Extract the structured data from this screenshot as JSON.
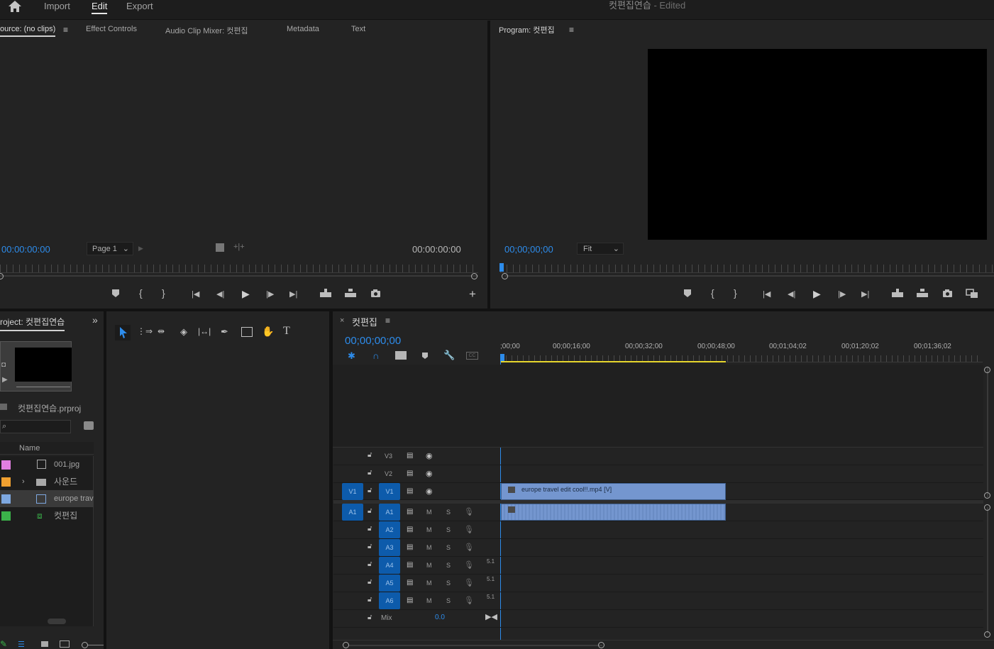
{
  "menu": {
    "import": "Import",
    "edit": "Edit",
    "export": "Export"
  },
  "window_title": "컷편집연습",
  "window_status": "- Edited",
  "source_panel": {
    "tabs": [
      "ource: (no clips)",
      "Effect Controls",
      "Audio Clip Mixer: 컷편집",
      "Metadata",
      "Text"
    ],
    "timecode_left": "00:00:00:00",
    "timecode_right": "00:00:00:00",
    "page_select": "Page 1"
  },
  "program_panel": {
    "tab": "Program: 컷편집",
    "timecode": "00;00;00;00",
    "fit_select": "Fit"
  },
  "project_panel": {
    "tab": "roject: 컷편집연습",
    "file": "컷편집연습.prproj",
    "column_name": "Name",
    "items": [
      {
        "label": "001.jpg",
        "color": "#e07ee0",
        "icon": "image-icon"
      },
      {
        "label": "사운드",
        "color": "#f0a030",
        "icon": "folder-icon"
      },
      {
        "label": "europe trav",
        "color": "#7ea8e0",
        "icon": "video-clip-icon"
      },
      {
        "label": "컷편집",
        "color": "#3bb34a",
        "icon": "sequence-icon"
      }
    ]
  },
  "timeline": {
    "tab": "컷편집",
    "timecode": "00;00;00;00",
    "ruler": [
      ";00;00",
      "00;00;16;00",
      "00;00;32;00",
      "00;00;48;00",
      "00;01;04;02",
      "00;01;20;02",
      "00;01;36;02"
    ],
    "video_tracks": [
      "V3",
      "V2",
      "V1"
    ],
    "audio_tracks": [
      "A1",
      "A2",
      "A3",
      "A4",
      "A5",
      "A6"
    ],
    "source_video": "V1",
    "source_audio": "A1",
    "mute": "M",
    "solo": "S",
    "channel_label": "5.1",
    "mix_label": "Mix",
    "mix_value": "0.0",
    "clip_video": "europe travel edit cool!!.mp4 [V]"
  },
  "colors": {
    "accent": "#2d8ceb",
    "clip": "#7496cf",
    "work_area": "#e6d62c"
  }
}
